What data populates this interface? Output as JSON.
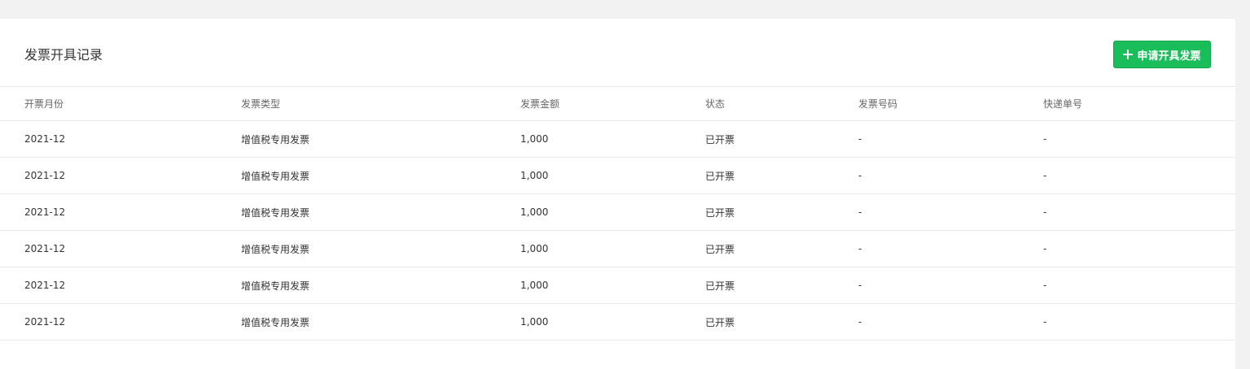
{
  "header": {
    "title": "发票开具记录",
    "apply_button_label": "申请开具发票",
    "accent_color": "#19be5b"
  },
  "table": {
    "columns": [
      "开票月份",
      "发票类型",
      "发票金额",
      "状态",
      "发票号码",
      "快递单号"
    ],
    "rows": [
      [
        "2021-12",
        "增值税专用发票",
        "1,000",
        "已开票",
        "-",
        "-"
      ],
      [
        "2021-12",
        "增值税专用发票",
        "1,000",
        "已开票",
        "-",
        "-"
      ],
      [
        "2021-12",
        "增值税专用发票",
        "1,000",
        "已开票",
        "-",
        "-"
      ],
      [
        "2021-12",
        "增值税专用发票",
        "1,000",
        "已开票",
        "-",
        "-"
      ],
      [
        "2021-12",
        "增值税专用发票",
        "1,000",
        "已开票",
        "-",
        "-"
      ],
      [
        "2021-12",
        "增值税专用发票",
        "1,000",
        "已开票",
        "-",
        "-"
      ]
    ]
  }
}
